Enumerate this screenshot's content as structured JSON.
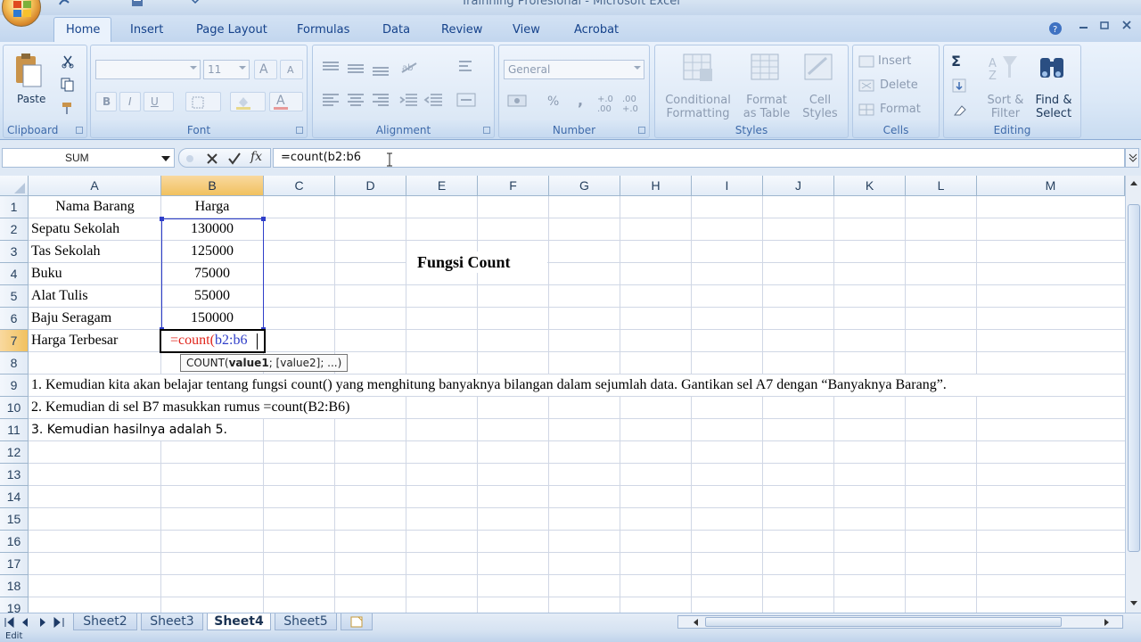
{
  "window": {
    "title": "Trainning Profesional - Microsoft Excel"
  },
  "tabs": [
    "Home",
    "Insert",
    "Page Layout",
    "Formulas",
    "Data",
    "Review",
    "View",
    "Acrobat"
  ],
  "active_tab": "Home",
  "ribbon": {
    "clipboard": {
      "label": "Clipboard",
      "paste": "Paste"
    },
    "font": {
      "label": "Font",
      "font_size": "11"
    },
    "alignment": {
      "label": "Alignment"
    },
    "number": {
      "label": "Number",
      "format": "General"
    },
    "styles": {
      "label": "Styles",
      "conditional_1": "Conditional",
      "conditional_2": "Formatting",
      "format_table_1": "Format",
      "format_table_2": "as Table",
      "cell_styles_1": "Cell",
      "cell_styles_2": "Styles"
    },
    "cells": {
      "label": "Cells",
      "insert": "Insert",
      "delete": "Delete",
      "format": "Format"
    },
    "editing": {
      "label": "Editing",
      "sort_1": "Sort &",
      "sort_2": "Filter",
      "find_1": "Find &",
      "find_2": "Select"
    }
  },
  "formula_bar": {
    "name_box": "SUM",
    "formula": "=count(b2:b6"
  },
  "columns": [
    "A",
    "B",
    "C",
    "D",
    "E",
    "F",
    "G",
    "H",
    "I",
    "J",
    "K",
    "L",
    "M"
  ],
  "rows": [
    "1",
    "2",
    "3",
    "4",
    "5",
    "6",
    "7",
    "8",
    "9",
    "10",
    "11",
    "12",
    "13",
    "14",
    "15",
    "16",
    "17",
    "18",
    "19"
  ],
  "cells": {
    "A1": "Nama Barang",
    "B1": "Harga",
    "A2": "Sepatu Sekolah",
    "B2": "130000",
    "A3": "Tas Sekolah",
    "B3": "125000",
    "A4": "Buku",
    "B4": "75000",
    "A5": "Alat Tulis",
    "B5": "55000",
    "A6": "Baju Seragam",
    "B6": "150000",
    "A7": "Harga Terbesar",
    "B7_prefix": "=count(",
    "B7_ref": "b2:b6",
    "E4": "Fungsi Count",
    "A9": "1. Kemudian kita akan belajar tentang fungsi count() yang menghitung banyaknya bilangan dalam sejumlah data. Gantikan sel A7 dengan “Banyaknya Barang”.",
    "A10": "2. Kemudian di sel B7 masukkan rumus =count(B2:B6)",
    "A11": "3. Kemudian hasilnya adalah 5."
  },
  "tooltip": {
    "fn": "COUNT(",
    "arg1": "value1",
    "rest": "; [value2]; ...)"
  },
  "sheets": [
    "Sheet2",
    "Sheet3",
    "Sheet4",
    "Sheet5"
  ],
  "active_sheet": "Sheet4",
  "status": "Edit"
}
